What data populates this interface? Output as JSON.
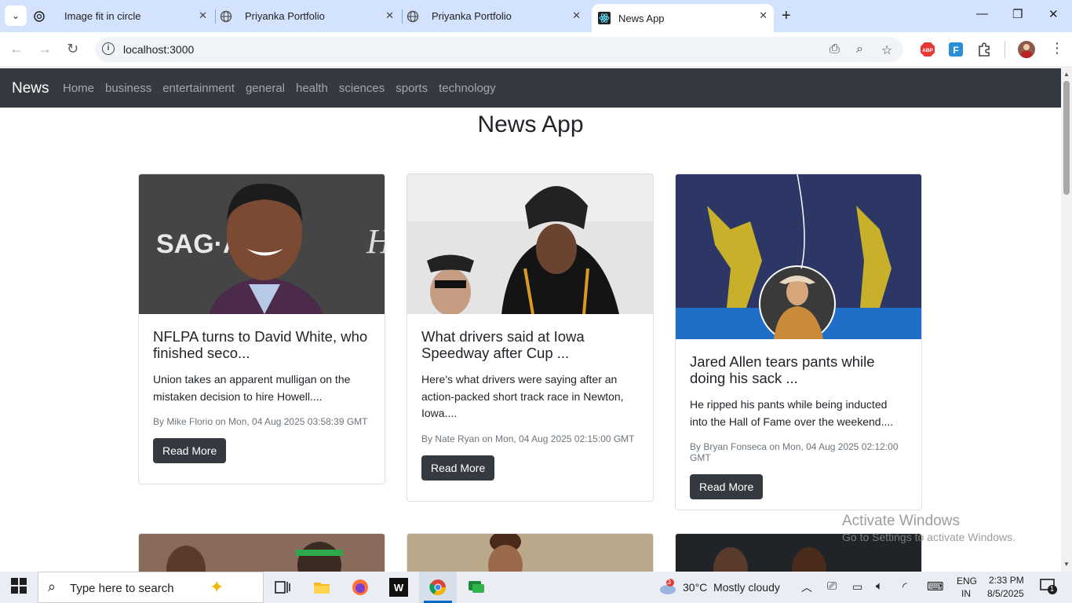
{
  "browser": {
    "tabs": [
      {
        "title": "Image fit in circle"
      },
      {
        "title": "Priyanka Portfolio"
      },
      {
        "title": "Priyanka Portfolio"
      },
      {
        "title": "News App"
      }
    ],
    "address": "localhost:3000"
  },
  "navbar": {
    "brand": "News",
    "links": [
      "Home",
      "business",
      "entertainment",
      "general",
      "health",
      "sciences",
      "sports",
      "technology"
    ]
  },
  "page": {
    "title": "News App",
    "cards": [
      {
        "title": "NFLPA turns to David White, who finished seco...",
        "description": "Union takes an apparent mulligan on the mistaken decision to hire Howell....",
        "meta": "By Mike Florio on Mon, 04 Aug 2025 03:58:39 GMT",
        "button": "Read More"
      },
      {
        "title": "What drivers said at Iowa Speedway after Cup ...",
        "description": "Here's what drivers were saying after an action-packed short track race in Newton, Iowa....",
        "meta": "By Nate Ryan on Mon, 04 Aug 2025 02:15:00 GMT",
        "button": "Read More"
      },
      {
        "title": "Jared Allen tears pants while doing his sack ...",
        "description": "He ripped his pants while being inducted into the Hall of Fame over the weekend....",
        "meta": "By Bryan Fonseca on Mon, 04 Aug 2025 02:12:00 GMT",
        "button": "Read More"
      }
    ]
  },
  "watermark": {
    "line1": "Activate Windows",
    "line2": "Go to Settings to activate Windows."
  },
  "taskbar": {
    "search_placeholder": "Type here to search",
    "weather": "30°C  Mostly cloudy",
    "weather_badge": "3",
    "lang1": "ENG",
    "lang2": "IN",
    "time": "2:33 PM",
    "date": "8/5/2025",
    "notif_count": "1"
  }
}
